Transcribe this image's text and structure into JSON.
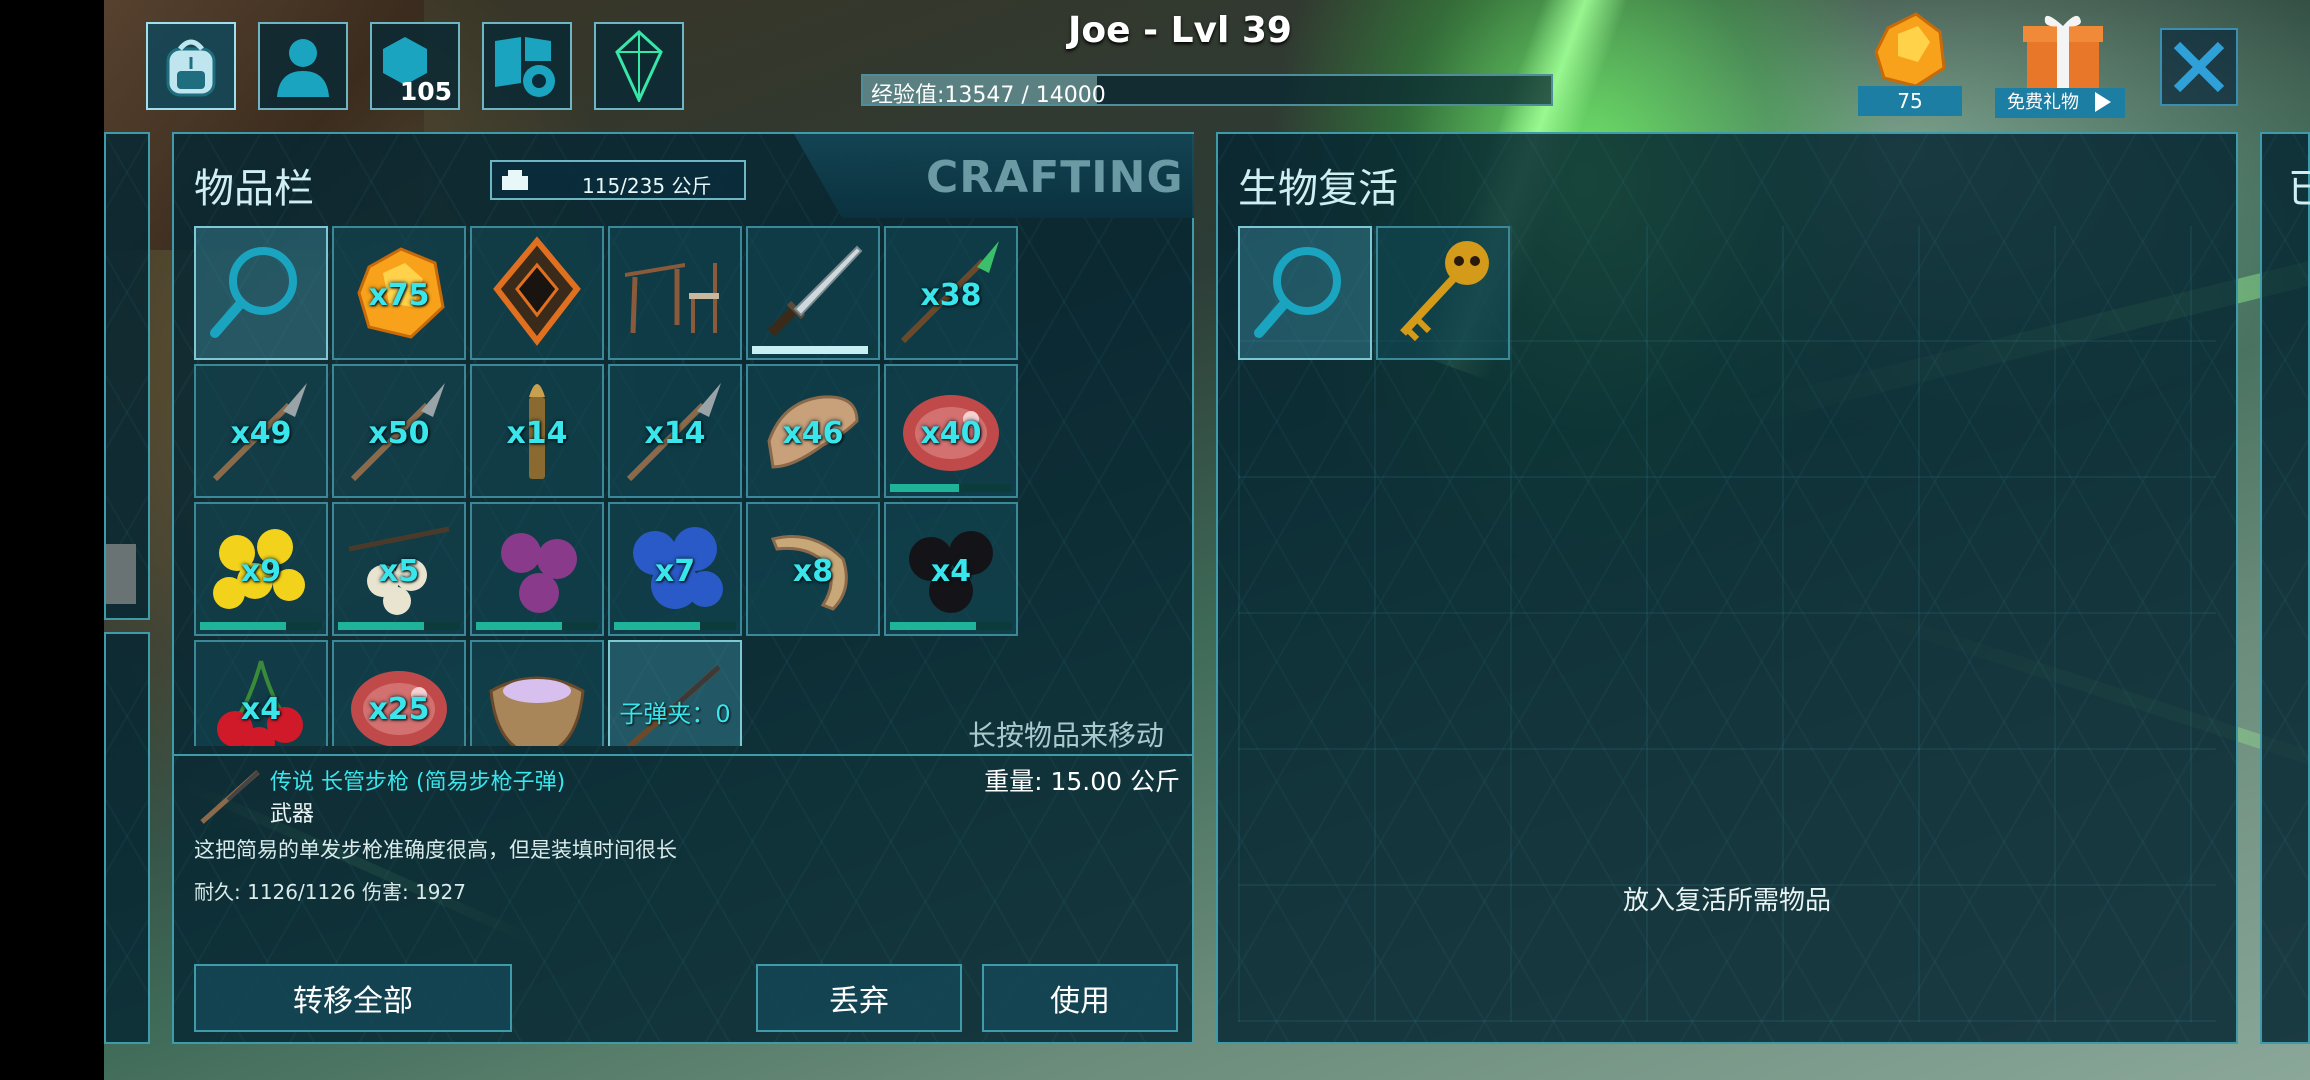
{
  "header": {
    "player_name": "Joe - Lvl 39",
    "xp_text": "经验值:13547 / 14000",
    "xp_progress": 0.34,
    "engram_points": "105",
    "amber_count": "75",
    "free_gift_label": "免费礼物"
  },
  "top_tabs": [
    {
      "name": "inventory",
      "icon": "backpack-icon"
    },
    {
      "name": "character",
      "icon": "person-icon"
    },
    {
      "name": "engrams",
      "icon": "hexagons-icon"
    },
    {
      "name": "settings",
      "icon": "book-gear-icon"
    },
    {
      "name": "element",
      "icon": "crystal-icon"
    }
  ],
  "inventory": {
    "title": "物品栏",
    "weight": "115/235 公斤",
    "crafting_tab": "CRAFTING",
    "hint": "长按物品来移动",
    "items": [
      {
        "id": "search",
        "qty": "",
        "icon": "search-icon"
      },
      {
        "id": "amber",
        "qty": "x75",
        "icon": "amber-icon"
      },
      {
        "id": "implant",
        "qty": "",
        "icon": "implant-icon"
      },
      {
        "id": "furniture",
        "qty": "",
        "icon": "table-chair-icon"
      },
      {
        "id": "sword",
        "qty": "",
        "icon": "sword-icon",
        "durability": 0.92
      },
      {
        "id": "spear-green",
        "qty": "x38",
        "icon": "spear-icon"
      },
      {
        "id": "arrow1",
        "qty": "x49",
        "icon": "arrow-icon"
      },
      {
        "id": "arrow2",
        "qty": "x50",
        "icon": "arrow-icon"
      },
      {
        "id": "bullet",
        "qty": "x14",
        "icon": "bullet-icon"
      },
      {
        "id": "arrow3",
        "qty": "x14",
        "icon": "arrow-icon"
      },
      {
        "id": "hide",
        "qty": "x46",
        "icon": "hide-icon"
      },
      {
        "id": "meat",
        "qty": "x40",
        "icon": "meat-icon",
        "freshness": 0.55
      },
      {
        "id": "amarberry",
        "qty": "x9",
        "icon": "berry-yellow-icon",
        "freshness": 0.68
      },
      {
        "id": "tintoberry",
        "qty": "x5",
        "icon": "berry-white-icon",
        "freshness": 0.68
      },
      {
        "id": "azulberry",
        "qty": "",
        "icon": "berry-purple-icon",
        "freshness": 0.68
      },
      {
        "id": "mejoberry",
        "qty": "x7",
        "icon": "berry-blue-icon",
        "freshness": 0.68
      },
      {
        "id": "wood",
        "qty": "x8",
        "icon": "wood-icon"
      },
      {
        "id": "narcoberry",
        "qty": "x4",
        "icon": "berry-black-icon",
        "freshness": 0.68
      },
      {
        "id": "cherry",
        "qty": "x4",
        "icon": "cherry-icon"
      },
      {
        "id": "meat2",
        "qty": "x25",
        "icon": "meat-icon"
      },
      {
        "id": "bowl",
        "qty": "",
        "icon": "bowl-icon"
      },
      {
        "id": "rifle",
        "qty": "子弹夹：0",
        "icon": "rifle-icon"
      }
    ],
    "selected": {
      "name": "传说 长管步枪 (简易步枪子弹)",
      "type": "武器",
      "description": "这把简易的单发步枪准确度很高，但是装填时间很长",
      "stats": "耐久: 1126/1126  伤害: 1927",
      "weight": "重量: 15.00 公斤"
    },
    "buttons": {
      "transfer_all": "转移全部",
      "drop": "丢弃",
      "use": "使用"
    }
  },
  "revive": {
    "title": "生物复活",
    "hint": "放入复活所需物品",
    "items": [
      {
        "id": "search",
        "icon": "search-icon"
      },
      {
        "id": "key",
        "icon": "skull-key-icon"
      }
    ],
    "peek_char": "已"
  },
  "colors": {
    "accent": "#38e6ec",
    "panel_border": "#3f9aaa",
    "button_blue": "#1d7ea3",
    "freshness_bar": "#1fb39a"
  }
}
